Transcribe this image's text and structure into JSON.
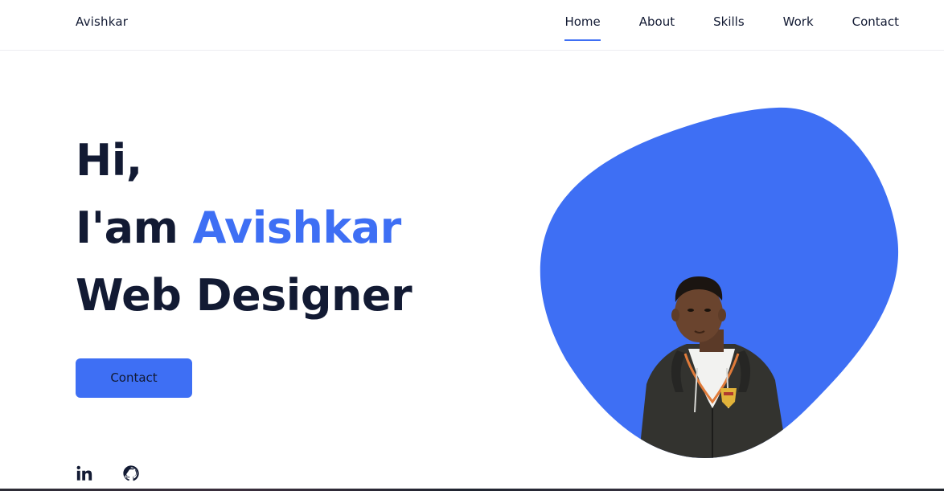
{
  "brand": {
    "name": "Avishkar"
  },
  "nav": {
    "items": [
      {
        "label": "Home",
        "active": true
      },
      {
        "label": "About",
        "active": false
      },
      {
        "label": "Skills",
        "active": false
      },
      {
        "label": "Work",
        "active": false
      },
      {
        "label": "Contact",
        "active": false
      }
    ]
  },
  "hero": {
    "greeting": "Hi,",
    "intro_prefix": "I'am",
    "name": "Avishkar",
    "role": "Web Designer",
    "cta_label": "Contact"
  },
  "social": {
    "icons": [
      "linkedin-icon",
      "github-icon"
    ]
  },
  "colors": {
    "accent": "#3e6ff4",
    "text": "#121a33",
    "background": "#ffffff"
  }
}
